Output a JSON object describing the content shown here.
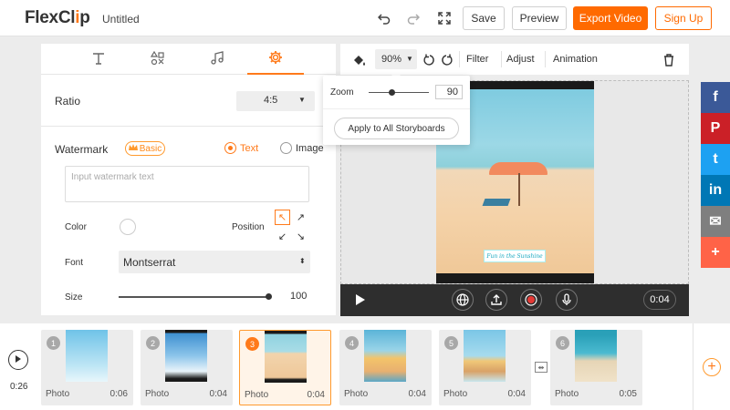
{
  "header": {
    "logo_pre": "FlexCl",
    "logo_o": "i",
    "logo_post": "p",
    "doc_title": "Untitled",
    "save_label": "Save",
    "preview_label": "Preview",
    "export_label": "Export Video",
    "signup_label": "Sign Up"
  },
  "left_panel": {
    "tabs": [
      "text",
      "elements",
      "music",
      "settings"
    ],
    "active_tab": "settings",
    "ratio_label": "Ratio",
    "ratio_value": "4:5",
    "watermark_label": "Watermark",
    "basic_badge": "Basic",
    "radio_text": "Text",
    "radio_image": "Image",
    "watermark_placeholder": "Input watermark text",
    "color_label": "Color",
    "position_label": "Position",
    "font_label": "Font",
    "font_value": "Montserrat",
    "size_label": "Size",
    "size_value": "100"
  },
  "canvas_toolbar": {
    "zoom_value": "90%",
    "filter_label": "Filter",
    "adjust_label": "Adjust",
    "animation_label": "Animation"
  },
  "zoom_popup": {
    "label": "Zoom",
    "value": "90",
    "apply_label": "Apply to All Storyboards"
  },
  "stage": {
    "caption": "Fun in the Sunshine"
  },
  "player": {
    "time": "0:04"
  },
  "social": [
    {
      "name": "facebook",
      "glyph": "f",
      "color": "#3b5998"
    },
    {
      "name": "pinterest",
      "glyph": "P",
      "color": "#cb2027"
    },
    {
      "name": "twitter",
      "glyph": "t",
      "color": "#1da1f2"
    },
    {
      "name": "linkedin",
      "glyph": "in",
      "color": "#0077b5"
    },
    {
      "name": "email",
      "glyph": "✉",
      "color": "#7f7f7f"
    },
    {
      "name": "more",
      "glyph": "+",
      "color": "#ff6347"
    }
  ],
  "timeline": {
    "current_time": "0:26",
    "clips": [
      {
        "num": "1",
        "type": "Photo",
        "duration": "0:06"
      },
      {
        "num": "2",
        "type": "Photo",
        "duration": "0:04"
      },
      {
        "num": "3",
        "type": "Photo",
        "duration": "0:04"
      },
      {
        "num": "4",
        "type": "Photo",
        "duration": "0:04"
      },
      {
        "num": "5",
        "type": "Photo",
        "duration": "0:04"
      },
      {
        "num": "6",
        "type": "Photo",
        "duration": "0:05"
      }
    ],
    "active_clip": "3"
  }
}
